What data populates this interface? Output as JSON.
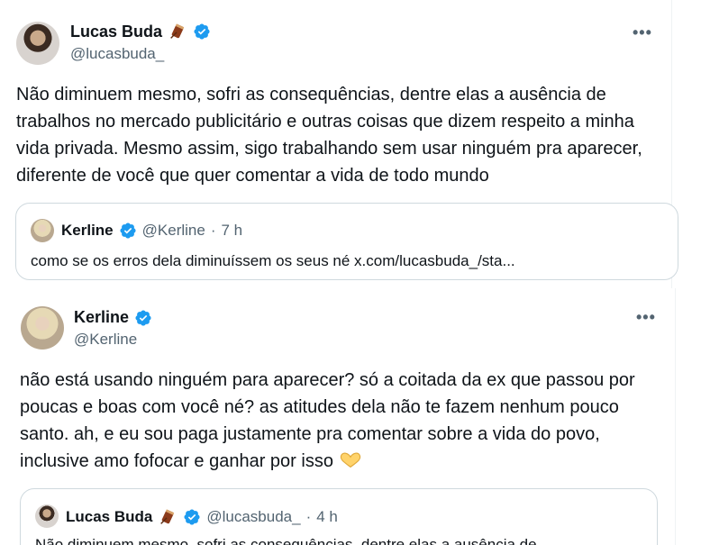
{
  "tweet1": {
    "author_name": "Lucas Buda",
    "author_handle": "@lucasbuda_",
    "more_label": "•••",
    "text": "Não diminuem mesmo, sofri as consequências, dentre elas a ausência de trabalhos no mercado publicitário e outras coisas que dizem respeito a minha vida privada. Mesmo assim, sigo trabalhando sem usar ninguém pra aparecer, diferente de você que quer comentar a vida de todo mundo",
    "quote": {
      "author_name": "Kerline",
      "author_handle": "@Kerline",
      "separator": "·",
      "time": "7 h",
      "text": "como se os erros dela diminuíssem os seus né x.com/lucasbuda_/sta..."
    }
  },
  "tweet2": {
    "author_name": "Kerline",
    "author_handle": "@Kerline",
    "more_label": "•••",
    "text": "não está usando ninguém para aparecer? só a coitada da ex que passou por poucas e boas com você né? as atitudes dela não te fazem nenhum pouco santo. ah, e eu sou paga justamente pra comentar sobre a vida do povo, inclusive amo fofocar e ganhar por isso",
    "quote": {
      "author_name": "Lucas Buda",
      "author_handle": "@lucasbuda_",
      "separator": "·",
      "time": "4 h",
      "text": "Não diminuem mesmo, sofri as consequências, dentre elas a ausência de"
    }
  },
  "icons": {
    "verified": "verified-badge-icon",
    "drum": "drum-emoji-icon",
    "heart_hands": "heart-hands-emoji-icon",
    "more": "more-options-icon"
  },
  "colors": {
    "verified_blue": "#1d9bf0",
    "text_primary": "#0f1419",
    "text_secondary": "#536471",
    "border": "#cfd9de"
  }
}
